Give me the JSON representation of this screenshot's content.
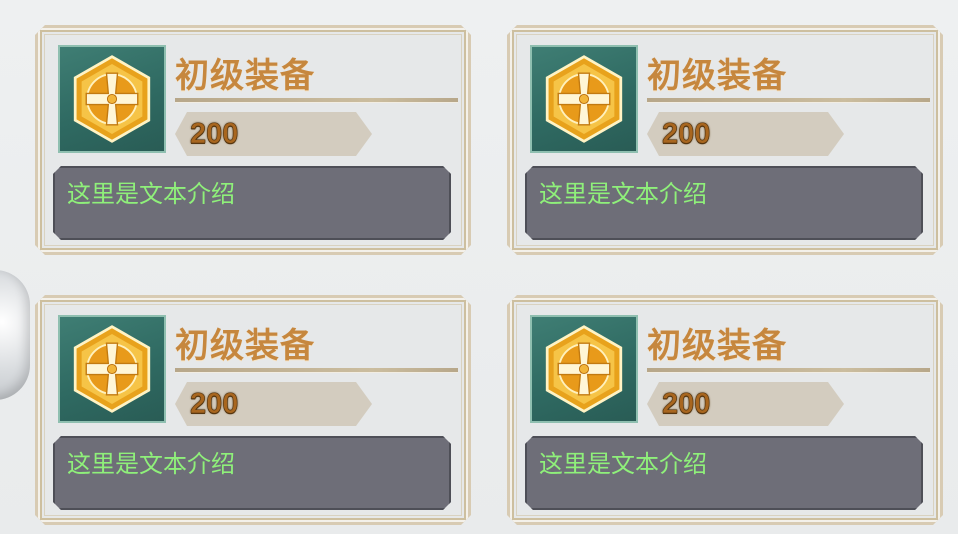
{
  "cards": [
    {
      "title": "初级装备",
      "price": "200",
      "description": "这里是文本介绍",
      "icon": "golden-cross-emblem-icon"
    },
    {
      "title": "初级装备",
      "price": "200",
      "description": "这里是文本介绍",
      "icon": "golden-cross-emblem-icon"
    },
    {
      "title": "初级装备",
      "price": "200",
      "description": "这里是文本介绍",
      "icon": "golden-cross-emblem-icon"
    },
    {
      "title": "初级装备",
      "price": "200",
      "description": "这里是文本介绍",
      "icon": "golden-cross-emblem-icon"
    }
  ],
  "colors": {
    "title": "#c6873e",
    "price": "#a8661f",
    "description": "#8ff07a",
    "icon_bg": "#2f6a62",
    "desc_bg": "#6e6e78"
  }
}
